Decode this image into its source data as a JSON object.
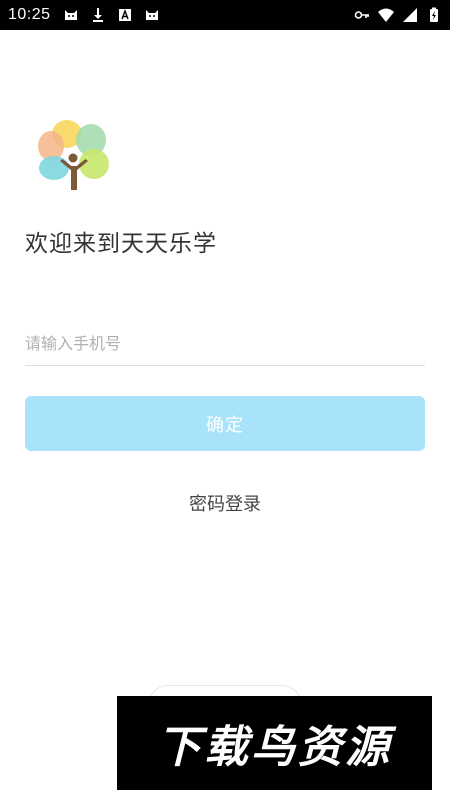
{
  "status_bar": {
    "time": "10:25",
    "left_icons": [
      "cat-app-icon",
      "download-icon",
      "a-app-icon",
      "cat-app-icon"
    ],
    "right_icons": [
      "vpn-key-icon",
      "wifi-icon",
      "signal-icon",
      "battery-charging-icon"
    ]
  },
  "login": {
    "welcome": "欢迎来到天天乐学",
    "phone_placeholder": "请输入手机号",
    "phone_value": "",
    "confirm_label": "确定",
    "password_login_label": "密码登录"
  },
  "watermark": {
    "text": "下载鸟资源"
  },
  "colors": {
    "confirm_button": "#a8e3fb",
    "status_bar": "#000000",
    "divider": "#dedede"
  }
}
